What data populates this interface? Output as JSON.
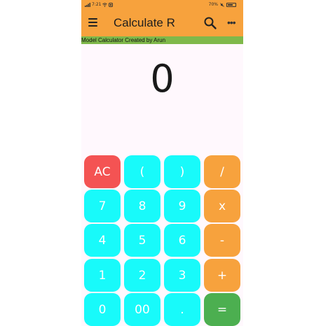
{
  "status_bar": {
    "time": "7:21",
    "battery": "70%",
    "battery_level": 0.7
  },
  "app_bar": {
    "title": "Calculate R",
    "more_label": "•••"
  },
  "banner": {
    "text": "Model Calculator Created by Arun"
  },
  "display": {
    "value": "0"
  },
  "keypad": {
    "ac": "AC",
    "open_paren": "(",
    "close_paren": ")",
    "divide": "/",
    "seven": "7",
    "eight": "8",
    "nine": "9",
    "multiply": "x",
    "four": "4",
    "five": "5",
    "six": "6",
    "minus": "-",
    "one": "1",
    "two": "2",
    "three": "3",
    "plus": "+",
    "zero": "0",
    "double_zero": "00",
    "dot": ".",
    "equals": "="
  },
  "colors": {
    "accent_orange": "#f7a23d",
    "digit_cyan": "#18fafa",
    "clear_red": "#f45353",
    "equals_green": "#4caf50",
    "banner_green": "#7fb84a"
  }
}
